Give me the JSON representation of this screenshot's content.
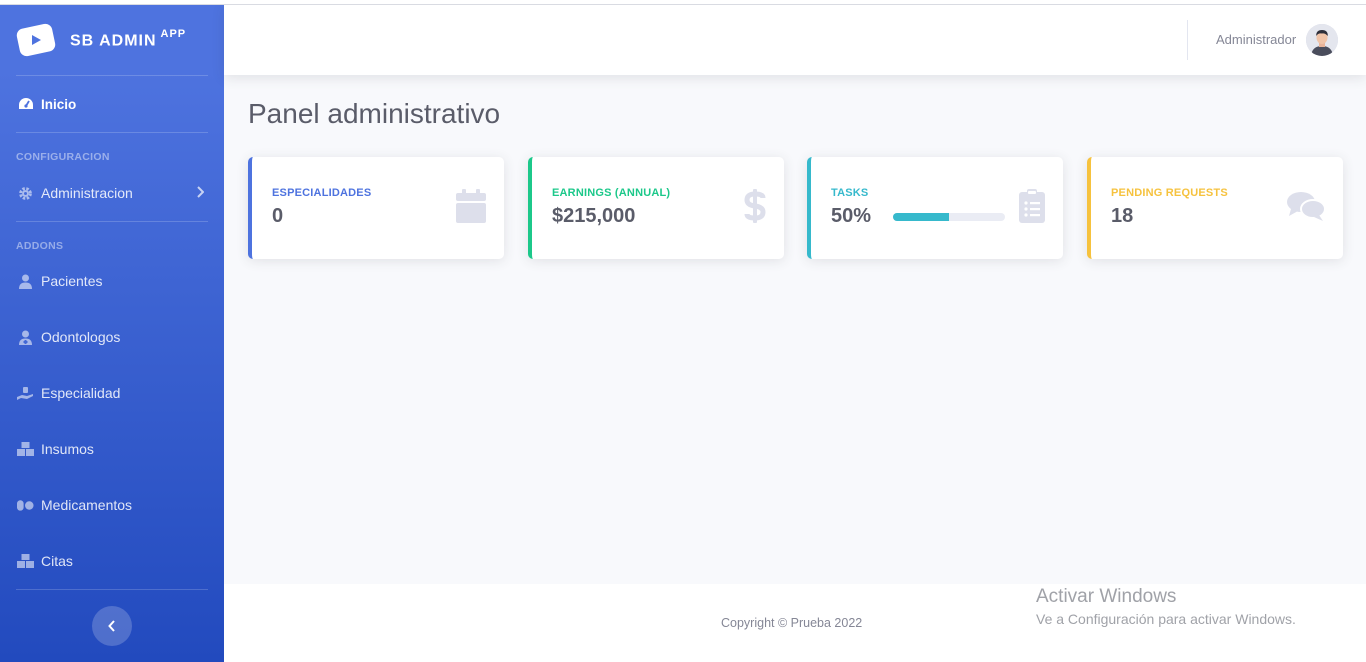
{
  "brand": {
    "name": "SB ADMIN",
    "sup": "APP"
  },
  "sidebar": {
    "home": "Inicio",
    "section_config": "CONFIGURACION",
    "admin": "Administracion",
    "section_addons": "ADDONS",
    "items": [
      {
        "label": "Pacientes",
        "icon": "user-icon"
      },
      {
        "label": "Odontologos",
        "icon": "user-doctor-icon"
      },
      {
        "label": "Especialidad",
        "icon": "hand-holding-icon"
      },
      {
        "label": "Insumos",
        "icon": "boxes-icon"
      },
      {
        "label": "Medicamentos",
        "icon": "pills-icon"
      },
      {
        "label": "Citas",
        "icon": "boxes-icon"
      }
    ]
  },
  "topbar": {
    "user_name": "Administrador"
  },
  "page": {
    "title": "Panel administrativo"
  },
  "cards": [
    {
      "label": "ESPECIALIDADES",
      "value": "0",
      "color": "#4e73df",
      "icon": "calendar-icon"
    },
    {
      "label": "EARNINGS (ANNUAL)",
      "value": "$215,000",
      "color": "#1cc88a",
      "icon": "dollar-icon"
    },
    {
      "label": "TASKS",
      "value": "50%",
      "color": "#36b9cc",
      "icon": "clipboard-list-icon",
      "progress": 50
    },
    {
      "label": "PENDING REQUESTS",
      "value": "18",
      "color": "#f6c23e",
      "icon": "comments-icon"
    }
  ],
  "footer": {
    "copyright": "Copyright © Prueba 2022"
  },
  "watermark": {
    "title": "Activar Windows",
    "subtitle": "Ve a Configuración para activar Windows."
  }
}
